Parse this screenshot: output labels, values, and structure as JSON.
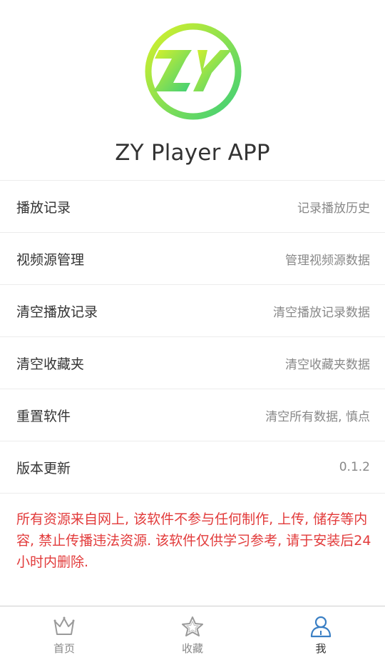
{
  "app": {
    "name": "ZY Player APP",
    "logo_text": "ZY",
    "colors": {
      "logo_gradient_start": "#d7f12a",
      "logo_gradient_end": "#3ccf78",
      "accent": "#3a7fc4",
      "notice": "#e23b3b"
    }
  },
  "menu": {
    "items": [
      {
        "title": "播放记录",
        "description": "记录播放历史"
      },
      {
        "title": "视频源管理",
        "description": "管理视频源数据"
      },
      {
        "title": "清空播放记录",
        "description": "清空播放记录数据"
      },
      {
        "title": "清空收藏夹",
        "description": "清空收藏夹数据"
      },
      {
        "title": "重置软件",
        "description": "清空所有数据, 慎点"
      },
      {
        "title": "版本更新",
        "description": "0.1.2"
      }
    ]
  },
  "notice": "所有资源来自网上, 该软件不参与任何制作, 上传, 储存等内容, 禁止传播违法资源. 该软件仅供学习参考, 请于安装后24小时内删除.",
  "tabbar": {
    "tabs": [
      {
        "label": "首页",
        "icon": "crown-icon",
        "active": false
      },
      {
        "label": "收藏",
        "icon": "star-icon",
        "active": false
      },
      {
        "label": "我",
        "icon": "user-icon",
        "active": true
      }
    ]
  }
}
